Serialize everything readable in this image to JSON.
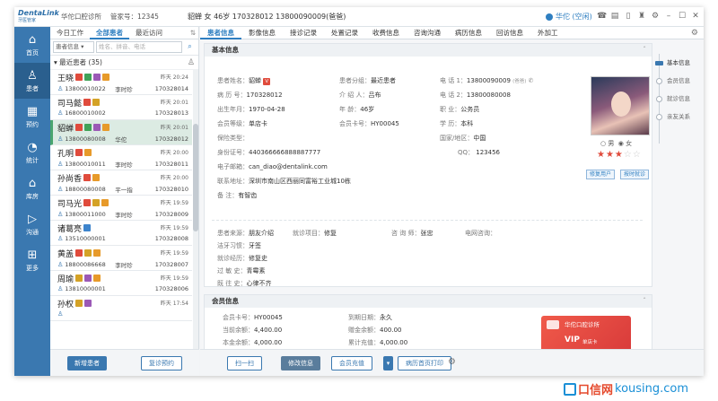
{
  "app": {
    "logo_line1": "DentaLink",
    "logo_line2": "牙医管家",
    "clinic": "华佗口腔诊所",
    "manager_no": "管家号：12345",
    "current_patient": "貂蝉  女  46岁   170328012   13800090009(爸爸)",
    "status": "华佗 (空闲)"
  },
  "titlebar_icons": [
    "phone-icon",
    "print-icon",
    "mobile-icon",
    "gift-icon",
    "settings-icon",
    "minimize-icon",
    "maximize-icon",
    "close-icon"
  ],
  "nav": [
    {
      "label": "首页",
      "icon": "⌂"
    },
    {
      "label": "患者",
      "icon": "♙"
    },
    {
      "label": "预约",
      "icon": "▦"
    },
    {
      "label": "统计",
      "icon": "◔"
    },
    {
      "label": "库房",
      "icon": "⌂"
    },
    {
      "label": "沟通",
      "icon": "▷"
    },
    {
      "label": "更多",
      "icon": "⊞"
    }
  ],
  "patient_list": {
    "tabs": [
      "今日工作",
      "全部患者",
      "最近访问"
    ],
    "search_select": "患者信息",
    "search_placeholder": "姓名、拼音、电话",
    "group": "最近患者 (35)",
    "patients": [
      {
        "name": "王晓",
        "time": "昨天 20:24",
        "phone": "13800010022",
        "doctor": "李时珍",
        "id": "170328014",
        "badges": [
          "b-r",
          "b-g",
          "b-p",
          "b-o"
        ]
      },
      {
        "name": "司马懿",
        "time": "昨天 20:01",
        "phone": "16800010002",
        "doctor": "",
        "id": "170328013",
        "badges": [
          "b-r",
          "b-y"
        ]
      },
      {
        "name": "貂蝉",
        "time": "昨天 20:01",
        "phone": "13800080008",
        "doctor": "华佗",
        "id": "170328012",
        "badges": [
          "b-r",
          "b-g",
          "b-p",
          "b-o"
        ]
      },
      {
        "name": "孔明",
        "time": "昨天 20:00",
        "phone": "13800010011",
        "doctor": "李时珍",
        "id": "170328011",
        "badges": [
          "b-r",
          "b-o"
        ]
      },
      {
        "name": "孙尚香",
        "time": "昨天 20:00",
        "phone": "18800080008",
        "doctor": "平一指",
        "id": "170328010",
        "badges": [
          "b-r",
          "b-o"
        ]
      },
      {
        "name": "司马光",
        "time": "昨天 19:59",
        "phone": "13800011000",
        "doctor": "李时珍",
        "id": "170328009",
        "badges": [
          "b-r",
          "b-y",
          "b-o"
        ]
      },
      {
        "name": "诸葛亮",
        "time": "昨天 19:59",
        "phone": "13510000001",
        "doctor": "",
        "id": "170328008",
        "badges": [
          "b-b"
        ]
      },
      {
        "name": "黄盖",
        "time": "昨天 19:59",
        "phone": "18800086668",
        "doctor": "李时珍",
        "id": "170328007",
        "badges": [
          "b-r",
          "b-y",
          "b-o"
        ]
      },
      {
        "name": "周瑜",
        "time": "昨天 19:59",
        "phone": "13810000001",
        "doctor": "",
        "id": "170328006",
        "badges": [
          "b-y",
          "b-p",
          "b-o"
        ]
      },
      {
        "name": "孙权",
        "time": "昨天 17:54",
        "phone": "",
        "doctor": "",
        "id": "",
        "badges": [
          "b-y",
          "b-p"
        ]
      }
    ],
    "btn_new": "新增患者",
    "btn_revisit": "复诊预约"
  },
  "main": {
    "tabs": [
      "患者信息",
      "影像信息",
      "接诊记录",
      "处置记录",
      "收费信息",
      "咨询沟通",
      "病历信息",
      "回访信息",
      "外加工"
    ],
    "basic_title": "基本信息",
    "basic": {
      "name_k": "患者姓名：",
      "name_v": "貂蝉",
      "group_k": "患者分组：",
      "group_v": "最近患者",
      "tel_k": "电    话 1：",
      "tel_v": "13800090009",
      "tel_note": "(爸爸)",
      "case_k": "病 历 号：",
      "case_v": "170328012",
      "intro_k": "介 绍 人：",
      "intro_v": "吕布",
      "tel2_k": "电    话 2：",
      "tel2_v": "13800080008",
      "birth_k": "出生年月：",
      "birth_v": "1970-04-28",
      "age_k": "年    龄：",
      "age_v": "46岁",
      "job_k": "职    业：",
      "job_v": "公务员",
      "level_k": "会员等级：",
      "level_v": "单店卡",
      "card_k": "会员卡号：",
      "card_v": "HY00045",
      "edu_k": "学    历：",
      "edu_v": "本科",
      "ins_k": "保险类型：",
      "region_k": "国家/地区：",
      "region_v": "中国",
      "idc_k": "身份证号：",
      "idc_v": "440366666888887777",
      "qq_k": "QQ：",
      "qq_v": "123456",
      "email_k": "电子邮箱：",
      "email_v": "can_diao@dentalink.com",
      "addr_k": "联系地址：",
      "addr_v": "深圳市南山区西丽同富裕工业城10栋",
      "note_k": "备    注：",
      "note_v": "有智齿"
    },
    "gender_male": "○ 男",
    "gender_female": "◉ 女",
    "stars": "★★★",
    "stars_off": "☆☆",
    "tag1": "修复用户",
    "tag2": "按时就诊",
    "extra": {
      "source_k": "患者来源：",
      "source_v": "朋友介绍",
      "item_k": "就诊项目：",
      "item_v": "修复",
      "consult_k": "咨 询 师：",
      "consult_v": "张忠",
      "netc_k": "电网咨询：",
      "habit_k": "洁牙习惯：",
      "habit_v": "牙签",
      "exp_k": "就诊经历：",
      "exp_v": "修复史",
      "allergy_k": "过 敏 史：",
      "allergy_v": "青霉素",
      "history_k": "既 往 史：",
      "history_v": "心律不齐"
    },
    "member_title": "会员信息",
    "member": {
      "card_k": "会员卡号：",
      "card_v": "HY00045",
      "expire_k": "到期日期：",
      "expire_v": "永久",
      "cur_k": "当前余额：",
      "cur_v": "4,400.00",
      "gift_k": "赠金余额：",
      "gift_v": "400.00",
      "base_k": "本金余额：",
      "base_v": "4,000.00",
      "total_k": "累计充值：",
      "total_v": "4,000.00"
    },
    "vip_clinic": "华佗口腔诊所",
    "vip_label": "VIP",
    "vip_sub": "单店卡",
    "side_nav": [
      "基本信息",
      "会员信息",
      "就诊信息",
      "亲友关系"
    ],
    "btn_scan": "扫一扫",
    "btn_edit": "修改信息",
    "btn_recharge": "会员充值",
    "btn_print": "病历首页打印"
  },
  "watermark": {
    "cn": "口信网",
    "domain": "kousing.com"
  }
}
